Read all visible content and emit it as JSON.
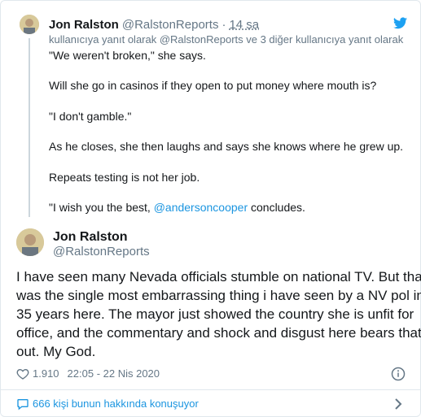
{
  "parent_tweet": {
    "author_name": "Jon Ralston",
    "author_handle": "@RalstonReports",
    "separator": "·",
    "time": "14 sa",
    "reply_context": "kullanıcıya yanıt olarak @RalstonReports ve 3 diğer kullanıcıya yanıt olarak",
    "paragraphs": [
      "\"We weren't broken,\" she says.",
      "Will she go in casinos if they open to put money where mouth is?",
      "\"I don't gamble.\"",
      "As he closes, she then laughs and says she knows where he grew up.",
      "Repeats testing is not her job."
    ],
    "last_para_prefix": "\"I wish you the best, ",
    "last_para_mention": "@andersoncooper",
    "last_para_suffix": " concludes."
  },
  "main_tweet": {
    "author_name": "Jon Ralston",
    "author_handle": "@RalstonReports",
    "text_lines": [
      "I have seen many Nevada officials stumble on national TV. But that",
      "was the single most embarrassing thing i have seen by a NV pol in",
      "35 years here. The mayor just showed the country she is unfit for",
      "office, and the commentary and shock and disgust here bears that",
      "out. My God."
    ],
    "likes": "1.910",
    "timestamp": "22:05 - 22 Nis 2020"
  },
  "discussion": {
    "label": "666 kişi bunun hakkında konuşuyor"
  },
  "colors": {
    "accent": "#1b95e0",
    "muted": "#657786",
    "text": "#14171a",
    "border": "#e1e8ed"
  },
  "icons": {
    "brand": "twitter-bird-icon",
    "like": "heart-icon",
    "info": "info-icon",
    "discussion": "speech-bubble-icon",
    "more": "chevron-right-icon"
  }
}
